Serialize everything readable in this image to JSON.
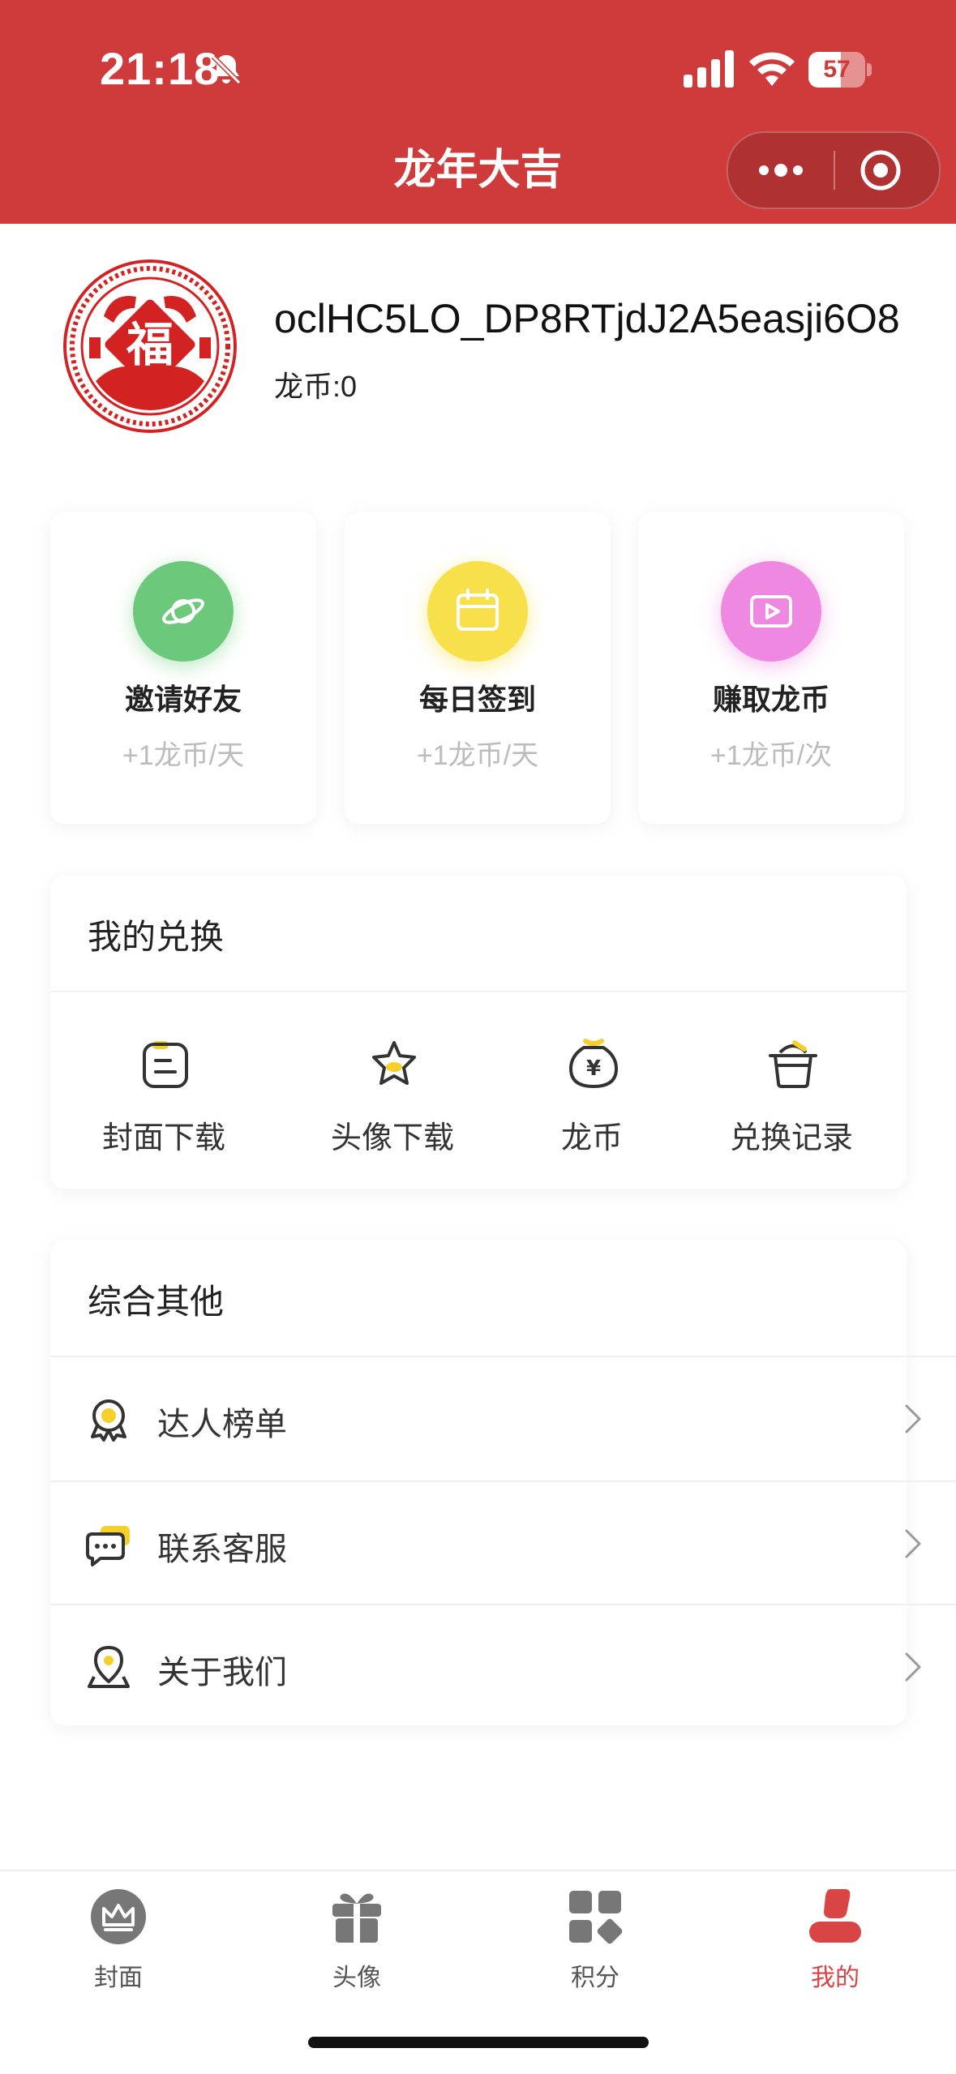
{
  "status_bar": {
    "time": "21:18",
    "battery": "57",
    "battery_level_percent": 57
  },
  "nav": {
    "title": "龙年大吉",
    "more_icon": "more-dots-icon",
    "close_icon": "target-circle-icon"
  },
  "profile": {
    "username": "oclHC5LO_DP8RTjdJ2A5easji6O8",
    "coins": "龙币:0",
    "avatar_icon": "fu-papercut-avatar"
  },
  "tasks": [
    {
      "label": "邀请好友",
      "sub": "+1龙币/天",
      "icon": "planet-icon",
      "color": "#6cc97c"
    },
    {
      "label": "每日签到",
      "sub": "+1龙币/天",
      "icon": "calendar-icon",
      "color": "#f7e04a"
    },
    {
      "label": "赚取龙币",
      "sub": "+1龙币/次",
      "icon": "video-play-icon",
      "color": "#ee88e0"
    }
  ],
  "exchange": {
    "title": "我的兑换",
    "items": [
      {
        "label": "封面下载",
        "icon": "cover-download-icon"
      },
      {
        "label": "头像下载",
        "icon": "star-download-icon"
      },
      {
        "label": "龙币",
        "icon": "yuan-coin-icon"
      },
      {
        "label": "兑换记录",
        "icon": "basket-record-icon"
      }
    ]
  },
  "others": {
    "title": "综合其他",
    "items": [
      {
        "label": "达人榜单",
        "icon": "medal-icon"
      },
      {
        "label": "联系客服",
        "icon": "chat-bubbles-icon"
      },
      {
        "label": "关于我们",
        "icon": "location-pin-icon"
      }
    ]
  },
  "tabbar": [
    {
      "label": "封面",
      "icon": "crown-icon"
    },
    {
      "label": "头像",
      "icon": "gift-icon"
    },
    {
      "label": "积分",
      "icon": "grid-diamond-icon"
    },
    {
      "label": "我的",
      "icon": "user-icon",
      "active": true
    }
  ],
  "colors": {
    "brand_red": "#cf3a3a",
    "accent_yellow": "#f5cf2a",
    "tab_active": "#d94545"
  }
}
